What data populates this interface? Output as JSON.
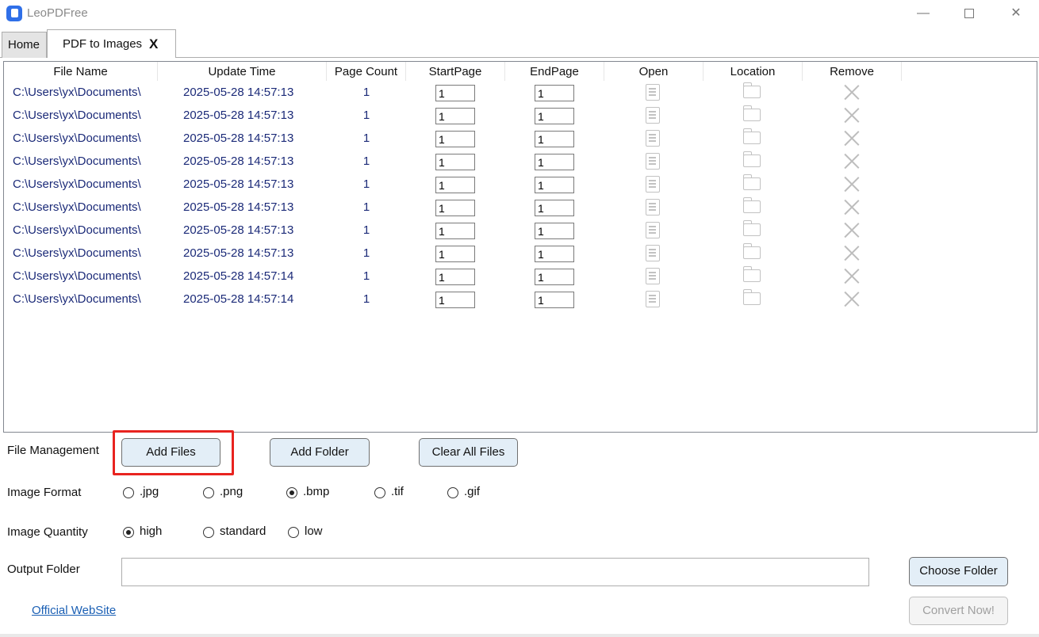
{
  "window": {
    "app_title": "LeoPDFree",
    "minimize_glyph": "—",
    "close_glyph": "✕"
  },
  "tabs": [
    {
      "label": "Home",
      "active": false
    },
    {
      "label": "PDF to Images",
      "active": true,
      "close_label": "X"
    }
  ],
  "table": {
    "columns": [
      "File Name",
      "Update Time",
      "Page Count",
      "StartPage",
      "EndPage",
      "Open",
      "Location",
      "Remove"
    ],
    "rows": [
      {
        "file_name": "C:\\Users\\yx\\Documents\\",
        "update_time": "2025-05-28 14:57:13",
        "page_count": "1",
        "start_page": "1",
        "end_page": "1"
      },
      {
        "file_name": "C:\\Users\\yx\\Documents\\",
        "update_time": "2025-05-28 14:57:13",
        "page_count": "1",
        "start_page": "1",
        "end_page": "1"
      },
      {
        "file_name": "C:\\Users\\yx\\Documents\\",
        "update_time": "2025-05-28 14:57:13",
        "page_count": "1",
        "start_page": "1",
        "end_page": "1"
      },
      {
        "file_name": "C:\\Users\\yx\\Documents\\",
        "update_time": "2025-05-28 14:57:13",
        "page_count": "1",
        "start_page": "1",
        "end_page": "1"
      },
      {
        "file_name": "C:\\Users\\yx\\Documents\\",
        "update_time": "2025-05-28 14:57:13",
        "page_count": "1",
        "start_page": "1",
        "end_page": "1"
      },
      {
        "file_name": "C:\\Users\\yx\\Documents\\",
        "update_time": "2025-05-28 14:57:13",
        "page_count": "1",
        "start_page": "1",
        "end_page": "1"
      },
      {
        "file_name": "C:\\Users\\yx\\Documents\\",
        "update_time": "2025-05-28 14:57:13",
        "page_count": "1",
        "start_page": "1",
        "end_page": "1"
      },
      {
        "file_name": "C:\\Users\\yx\\Documents\\",
        "update_time": "2025-05-28 14:57:13",
        "page_count": "1",
        "start_page": "1",
        "end_page": "1"
      },
      {
        "file_name": "C:\\Users\\yx\\Documents\\",
        "update_time": "2025-05-28 14:57:14",
        "page_count": "1",
        "start_page": "1",
        "end_page": "1"
      },
      {
        "file_name": "C:\\Users\\yx\\Documents\\",
        "update_time": "2025-05-28 14:57:14",
        "page_count": "1",
        "start_page": "1",
        "end_page": "1"
      }
    ],
    "row_icons": {
      "open": "document-icon",
      "location": "folder-icon",
      "remove": "close-x-icon"
    }
  },
  "file_management": {
    "label": "File Management",
    "add_files": "Add Files",
    "add_folder": "Add Folder",
    "clear_all": "Clear All Files"
  },
  "image_format": {
    "label": "Image Format",
    "options": [
      ".jpg",
      ".png",
      ".bmp",
      ".tif",
      ".gif"
    ],
    "selected": ".bmp"
  },
  "image_quantity": {
    "label": "Image Quantity",
    "options": [
      "high",
      "standard",
      "low"
    ],
    "selected": "high"
  },
  "output": {
    "label": "Output Folder",
    "value": "",
    "choose_button": "Choose Folder"
  },
  "footer": {
    "website_link": "Official WebSite",
    "convert_button": "Convert Now!"
  },
  "colors": {
    "highlight_box": "#e8231f",
    "row_text": "#1b2a78",
    "button_bg": "#e3eef7",
    "link": "#1a5fb4"
  }
}
